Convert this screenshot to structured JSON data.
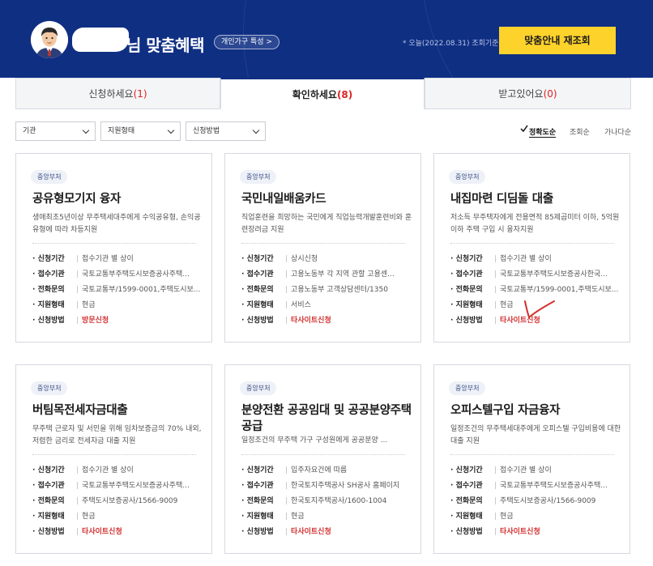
{
  "header": {
    "title": "님 맞춤혜택",
    "badge": "개인가구 특성 >",
    "today": "* 오늘(2022.08.31) 조회기준",
    "refresh_button": "맞춤안내 재조회"
  },
  "tabs": [
    {
      "label": "신청하세요",
      "count": "(1)"
    },
    {
      "label": "확인하세요",
      "count": "(8)"
    },
    {
      "label": "받고있어요",
      "count": "(0)"
    }
  ],
  "filters": {
    "agency": "기관",
    "support_type": "지원형태",
    "apply_method": "신청방법"
  },
  "sort": {
    "accuracy": "정확도순",
    "views": "조회순",
    "alpha": "가나다순"
  },
  "labels": {
    "period": "신청기간",
    "agency": "접수기관",
    "phone": "전화문의",
    "type": "지원형태",
    "method": "신청방법"
  },
  "cards": [
    {
      "tag": "중앙부처",
      "title": "공유형모기지 융자",
      "desc": "생애최초5년이상 무주택세대주에게 수익공유형, 손익공유형에 따라 차등지원",
      "period": "접수기관 별 상이",
      "agency": "국토교통부주택도시보증공사주택...",
      "phone": "국토교통부/1599-0001,주택도시보...",
      "type": "현금",
      "method": "방문신청"
    },
    {
      "tag": "중앙부처",
      "title": "국민내일배움카드",
      "desc": "직업훈련을 희망하는 국민에게 직업능력개발훈련비와 훈련장려금 지원",
      "period": "상시신청",
      "agency": "고용노동부 각 지역 관할 고용센...",
      "phone": "고용노동부 고객상담센터/1350",
      "type": "서비스",
      "method": "타사이트신청"
    },
    {
      "tag": "중앙부처",
      "title": "내집마련 디딤돌 대출",
      "desc": "저소득 무주택자에게 전용면적 85제곱미터 이하, 5억원 이하 주택 구입 시 융자지원",
      "period": "접수기관 별 상이",
      "agency": "국토교통부주택도시보증공사한국...",
      "phone": "국토교통부/1599-0001,주택도시보...",
      "type": "현금",
      "method": "타사이트신청"
    },
    {
      "tag": "중앙부처",
      "title": "버팀목전세자금대출",
      "desc": "무주택 근로자 및 서민을 위해 임차보증금의 70% 내외, 저렴한 금리로 전세자금 대출 지원",
      "period": "접수기관 별 상이",
      "agency": "국토교통부주택도시보증공사주택...",
      "phone": "주택도시보증공사/1566-9009",
      "type": "현금",
      "method": "타사이트신청"
    },
    {
      "tag": "중앙부처",
      "title": "분양전환 공공임대 및 공공분양주택공급",
      "desc": "일정조건의 무주택 가구 구성원에게 공공분양 ...",
      "period": "입주자요건에 따름",
      "agency": "한국토지주택공사 SH공사 홈페이지",
      "phone": "한국토지주택공사/1600-1004",
      "type": "현금",
      "method": "타사이트신청"
    },
    {
      "tag": "중앙부처",
      "title": "오피스텔구입 자금융자",
      "desc": "일정조건의 무주택세대주에게 오피스텔 구입비용에 대한 대출 지원",
      "period": "접수기관 별 상이",
      "agency": "국토교통부주택도시보증공사주택...",
      "phone": "주택도시보증공사/1566-9009",
      "type": "현금",
      "method": "타사이트신청"
    }
  ],
  "colors": {
    "banner": "#0f2f83",
    "accent_yellow": "#fdd22b",
    "red": "#d32f2f"
  }
}
